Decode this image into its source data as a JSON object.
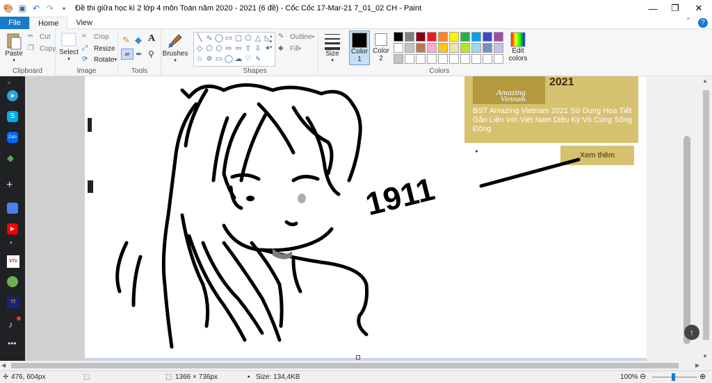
{
  "window": {
    "title": "Đề thi giữa học kì 2 lớp 4 môn Toán năm 2020 - 2021 (6 đề) - Cốc Cốc 17-Mar-21 7_01_02 CH - Paint",
    "minimize": "—",
    "maximize": "❐",
    "close": "✕"
  },
  "tabs": {
    "file": "File",
    "home": "Home",
    "view": "View"
  },
  "ribbon": {
    "clipboard": {
      "label": "Clipboard",
      "paste": "Paste",
      "cut": "Cut",
      "copy": "Copy"
    },
    "image": {
      "label": "Image",
      "select": "Select",
      "crop": "Crop",
      "resize": "Resize",
      "rotate": "Rotate"
    },
    "tools": {
      "label": "Tools"
    },
    "brushes": {
      "label": "Brushes"
    },
    "shapes": {
      "label": "Shapes",
      "outline": "Outline",
      "fill": "Fill"
    },
    "size": {
      "label": "Size"
    },
    "color1": {
      "label": "Color",
      "num": "1"
    },
    "color2": {
      "label": "Color",
      "num": "2"
    },
    "colors": {
      "label": "Colors",
      "edit": "Edit",
      "edit2": "colors"
    }
  },
  "palette": [
    "#000000",
    "#7f7f7f",
    "#880015",
    "#ed1c24",
    "#ff7f27",
    "#fff200",
    "#22b14c",
    "#00a2e8",
    "#3f48cc",
    "#a349a4",
    "#ffffff",
    "#c3c3c3",
    "#b97a57",
    "#ffaec9",
    "#ffc90e",
    "#efe4b0",
    "#b5e61d",
    "#99d9ea",
    "#7092be",
    "#c8bfe7",
    "#c3c3c3",
    "#ffffff",
    "#ffffff",
    "#ffffff",
    "#ffffff",
    "#ffffff",
    "#ffffff",
    "#ffffff",
    "#ffffff",
    "#ffffff"
  ],
  "canvas": {
    "ad_year": "2021",
    "ad_brand_1": "Amazing",
    "ad_brand_2": "Vietnam",
    "ad_text": "BST Amazing Vietnam 2021 Sử Dụng Họa Tiết Gắn Liền Với Việt Nam Diệu Kỳ Vô Cùng Sống Động",
    "ad_button": "Xem thêm",
    "drawing_number": "1911"
  },
  "status": {
    "cursor": "476, 604px",
    "dimensions": "1366 × 736px",
    "size": "Size: 134,4KB",
    "zoom": "100%"
  }
}
